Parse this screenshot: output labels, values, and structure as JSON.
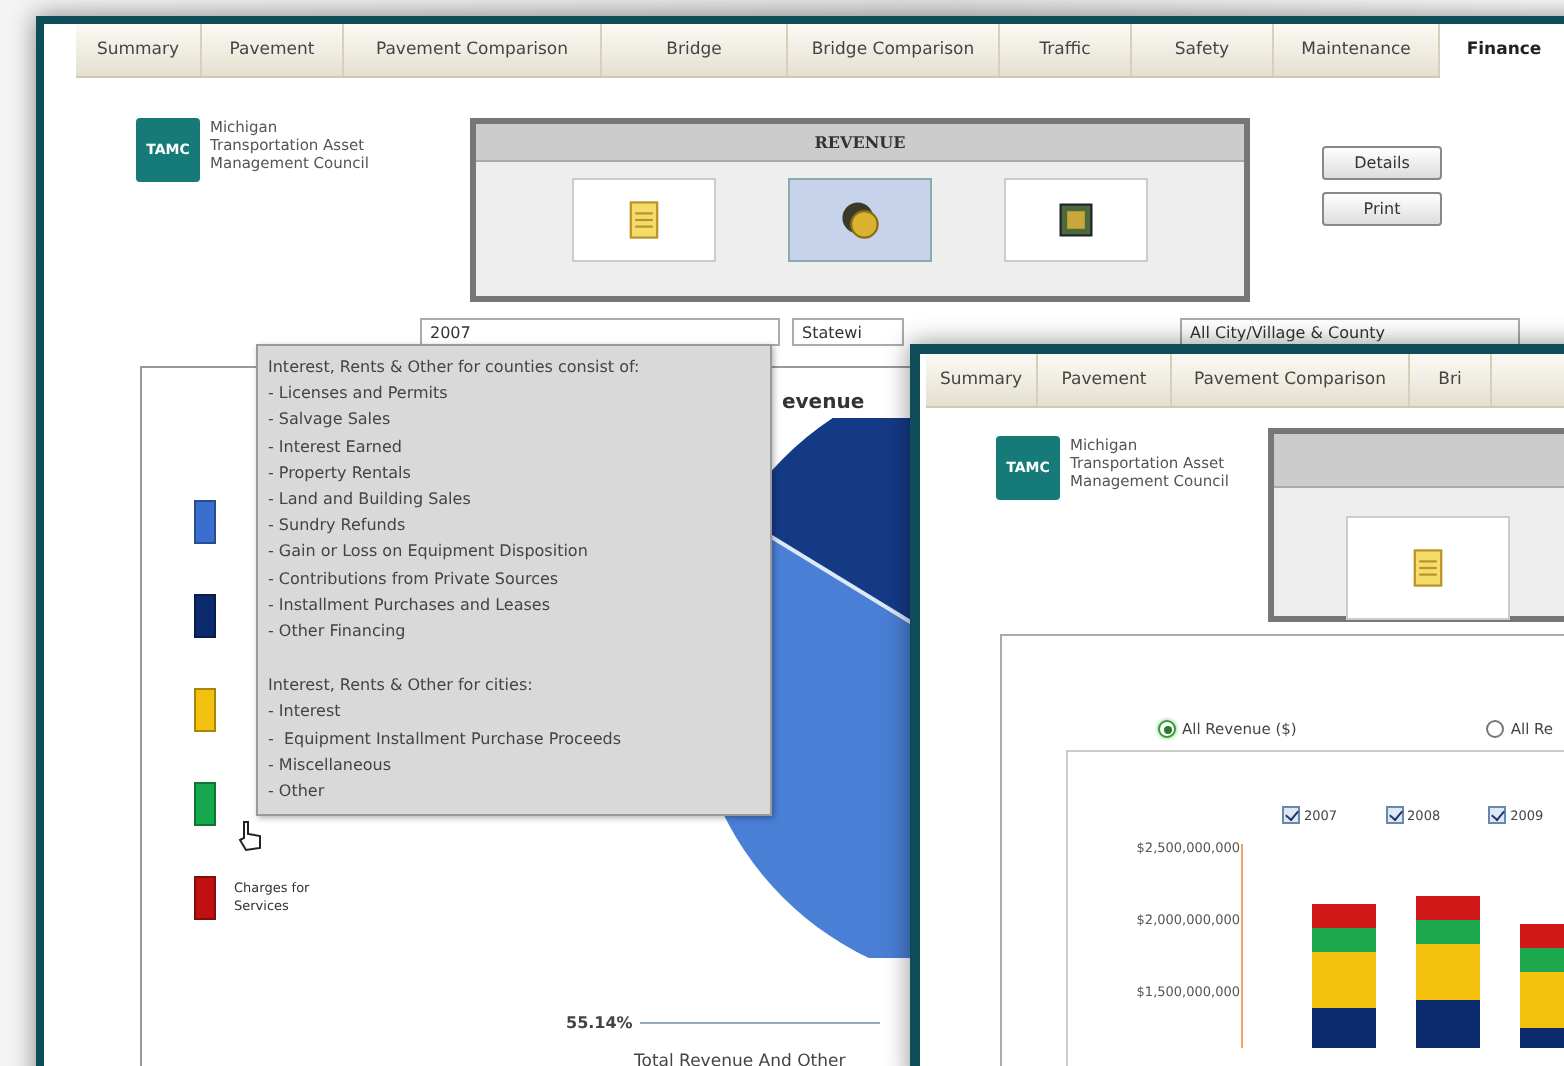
{
  "back_window": {
    "tabs": [
      {
        "label": "Summary",
        "selected": false
      },
      {
        "label": "Pavement",
        "selected": false
      },
      {
        "label": "Pavement Comparison",
        "selected": false
      },
      {
        "label": "Bridge",
        "selected": false
      },
      {
        "label": "Bridge Comparison",
        "selected": false
      },
      {
        "label": "Traffic",
        "selected": false
      },
      {
        "label": "Safety",
        "selected": false
      },
      {
        "label": "Maintenance",
        "selected": false
      },
      {
        "label": "Finance",
        "selected": true
      }
    ],
    "logo": {
      "mark": "TAMC",
      "name_lines": [
        "Michigan",
        "Transportation Asset",
        "Management Council"
      ]
    },
    "revenue_panel": {
      "title": "REVENUE",
      "options": [
        {
          "kind": "document",
          "selected": false
        },
        {
          "kind": "coins",
          "selected": true
        },
        {
          "kind": "chip",
          "selected": false
        }
      ]
    },
    "buttons": [
      "Details",
      "Print"
    ],
    "filters": [
      {
        "value": "2007"
      },
      {
        "value": "Statewi"
      },
      {
        "value": "All City/Village & County"
      }
    ],
    "chart": {
      "title": "evenue",
      "legend": [
        {
          "color": "#3a6fd0"
        },
        {
          "color": "#0c2a6e"
        },
        {
          "color": "#f2c10f"
        },
        {
          "color": "#16a84c"
        },
        {
          "color": "#c01010",
          "label": "Charges for Services"
        }
      ],
      "slice_label": "55.14%",
      "caption": "Total Revenue And Other"
    }
  },
  "tooltip": {
    "sections": [
      {
        "heading": "Interest, Rents & Other for counties consist of:",
        "items": [
          "- Licenses and Permits",
          "- Salvage Sales",
          "- Interest Earned",
          "- Property Rentals",
          "- Land and Building Sales",
          "- Sundry Refunds",
          "- Gain or Loss on Equipment Disposition",
          "- Contributions from Private Sources",
          "- Installment Purchases and Leases",
          "- Other Financing"
        ]
      },
      {
        "heading": "Interest, Rents & Other for cities:",
        "items": [
          "- Interest",
          "-  Equipment Installment Purchase Proceeds",
          "- Miscellaneous",
          "- Other"
        ]
      }
    ]
  },
  "front_window": {
    "tabs": [
      {
        "label": "Summary",
        "selected": false
      },
      {
        "label": "Pavement",
        "selected": false
      },
      {
        "label": "Pavement Comparison",
        "selected": false
      },
      {
        "label": "Bri",
        "selected": false
      }
    ],
    "logo": {
      "mark": "TAMC",
      "name_lines": [
        "Michigan",
        "Transportation Asset",
        "Management Council"
      ]
    },
    "revenue_panel": {
      "options": [
        {
          "kind": "document",
          "selected": false
        }
      ]
    },
    "chart": {
      "modes": [
        {
          "label": "All Revenue ($)",
          "selected": true
        },
        {
          "label": "All Re",
          "selected": false
        }
      ],
      "years": [
        {
          "label": "2007",
          "checked": true
        },
        {
          "label": "2008",
          "checked": true
        },
        {
          "label": "2009",
          "checked": true
        }
      ],
      "y_labels": [
        "$2,500,000,000",
        "$2,000,000,000",
        "$1,500,000,000"
      ]
    }
  }
}
